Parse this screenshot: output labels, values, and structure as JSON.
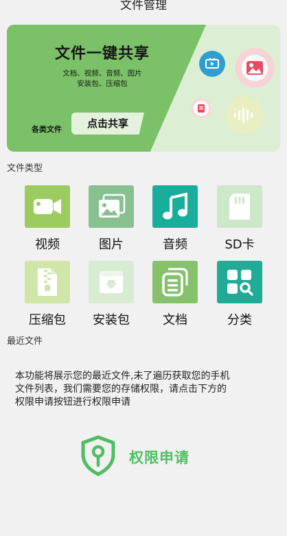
{
  "header": {
    "title": "文件管理"
  },
  "banner": {
    "title": "文件一键共享",
    "subtitle_line1": "文档、视频、音频、图片",
    "subtitle_line2": "安装包、压缩包",
    "category_label": "各类文件",
    "share_button": "点击共享",
    "icons": [
      "tv-icon",
      "image-icon",
      "document-icon",
      "waveform-icon"
    ]
  },
  "file_types": {
    "title": "文件类型",
    "items": [
      {
        "label": "视频",
        "icon": "video-camera-icon",
        "color": "#9ccb5f"
      },
      {
        "label": "图片",
        "icon": "gallery-icon",
        "color": "#87c192"
      },
      {
        "label": "音频",
        "icon": "music-note-icon",
        "color": "#19ad9c"
      },
      {
        "label": "SD卡",
        "icon": "sd-card-icon",
        "color": "#cde8c8"
      },
      {
        "label": "压缩包",
        "icon": "zip-file-icon",
        "color": "#cfe6a8"
      },
      {
        "label": "安装包",
        "icon": "install-package-icon",
        "color": "#d8ecd3"
      },
      {
        "label": "文档",
        "icon": "documents-icon",
        "color": "#86c26b"
      },
      {
        "label": "分类",
        "icon": "category-search-icon",
        "color": "#21aa95"
      }
    ]
  },
  "recent_files": {
    "title": "最近文件",
    "message_line1": "本功能将展示您的最近文件,未了遍历获取您的手机",
    "message_line2": "文件列表，我们需要您的存储权限，请点击下方的",
    "message_line3": "权限申请按钮进行权限申请",
    "permission_button": "权限申请",
    "accent_color": "#4fbe62"
  }
}
